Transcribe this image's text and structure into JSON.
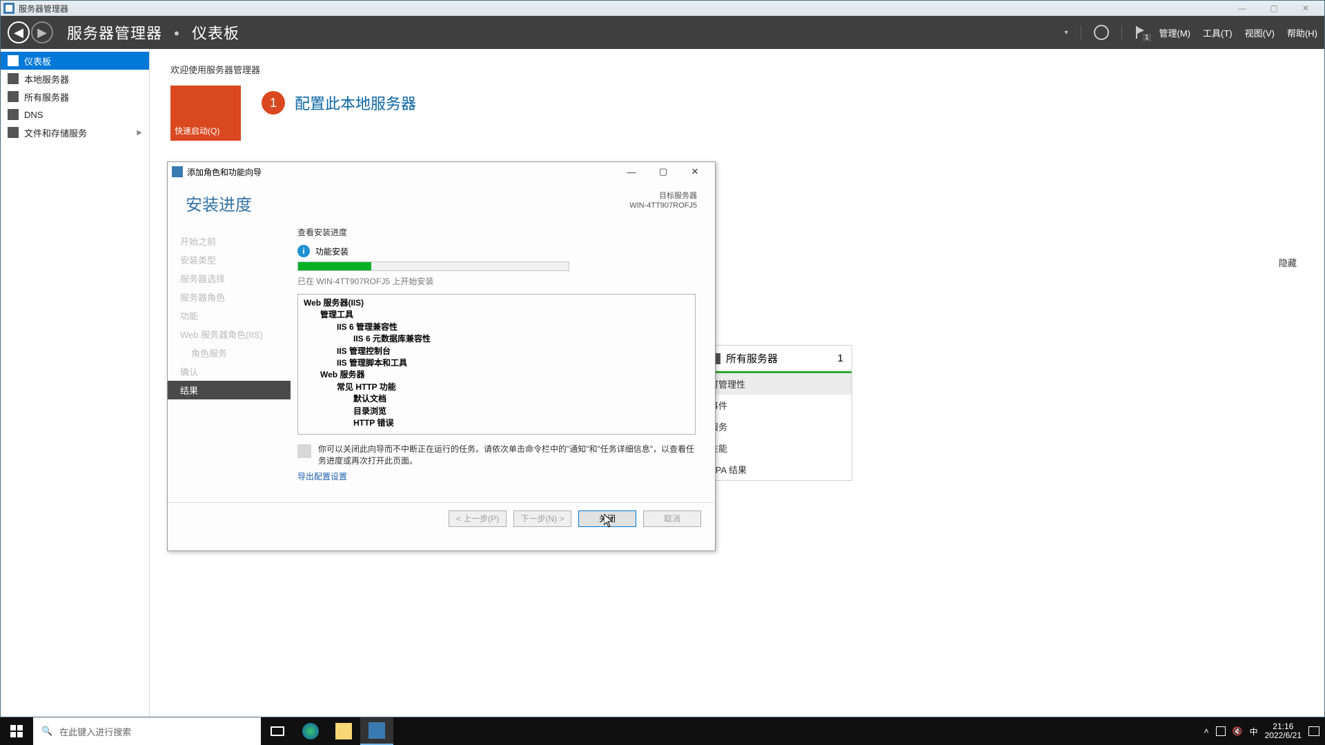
{
  "window": {
    "title": "服务器管理器"
  },
  "cmdbar": {
    "crumb1": "服务器管理器",
    "crumb2": "仪表板",
    "menu_manage": "管理(M)",
    "menu_tools": "工具(T)",
    "menu_view": "视图(V)",
    "menu_help": "帮助(H)",
    "flag_badge": "1"
  },
  "sidebar": {
    "items": [
      {
        "label": "仪表板"
      },
      {
        "label": "本地服务器"
      },
      {
        "label": "所有服务器"
      },
      {
        "label": "DNS"
      },
      {
        "label": "文件和存储服务"
      }
    ]
  },
  "main": {
    "welcome": "欢迎使用服务器管理器",
    "quick_tile": "快速启动(Q)",
    "config_num": "1",
    "config_text": "配置此本地服务器",
    "hide": "隐藏"
  },
  "card": {
    "title": "所有服务器",
    "count": "1",
    "rows": [
      "可管理性",
      "事件",
      "服务",
      "性能",
      "BPA 结果"
    ]
  },
  "wizard": {
    "title": "添加角色和功能向导",
    "heading": "安装进度",
    "target_label": "目标服务器",
    "target_value": "WIN-4TT907ROFJ5",
    "steps": [
      "开始之前",
      "安装类型",
      "服务器选择",
      "服务器角色",
      "功能",
      "Web 服务器角色(IIS)",
      "角色服务",
      "确认",
      "结果"
    ],
    "subhead": "查看安装进度",
    "status": "功能安装",
    "progress_msg": "已在 WIN-4TT907ROFJ5 上开始安装",
    "tree": [
      {
        "lvl": 0,
        "text": "Web 服务器(IIS)"
      },
      {
        "lvl": 1,
        "text": "管理工具"
      },
      {
        "lvl": 2,
        "text": "IIS 6 管理兼容性"
      },
      {
        "lvl": 3,
        "text": "IIS 6 元数据库兼容性"
      },
      {
        "lvl": 2,
        "text": "IIS 管理控制台"
      },
      {
        "lvl": 2,
        "text": "IIS 管理脚本和工具"
      },
      {
        "lvl": 1,
        "text": "Web 服务器"
      },
      {
        "lvl": 2,
        "text": "常见 HTTP 功能"
      },
      {
        "lvl": 3,
        "text": "默认文档"
      },
      {
        "lvl": 3,
        "text": "目录浏览"
      },
      {
        "lvl": 3,
        "text": "HTTP 错误"
      }
    ],
    "note": "你可以关闭此向导而不中断正在运行的任务。请依次单击命令栏中的\"通知\"和\"任务详细信息\"，以查看任务进度或再次打开此页面。",
    "export_link": "导出配置设置",
    "btn_prev": "< 上一步(P)",
    "btn_next": "下一步(N) >",
    "btn_close": "关闭",
    "btn_cancel": "取消"
  },
  "taskbar": {
    "search_placeholder": "在此键入进行搜索",
    "time": "21:16",
    "date": "2022/6/21",
    "ime": "中"
  }
}
